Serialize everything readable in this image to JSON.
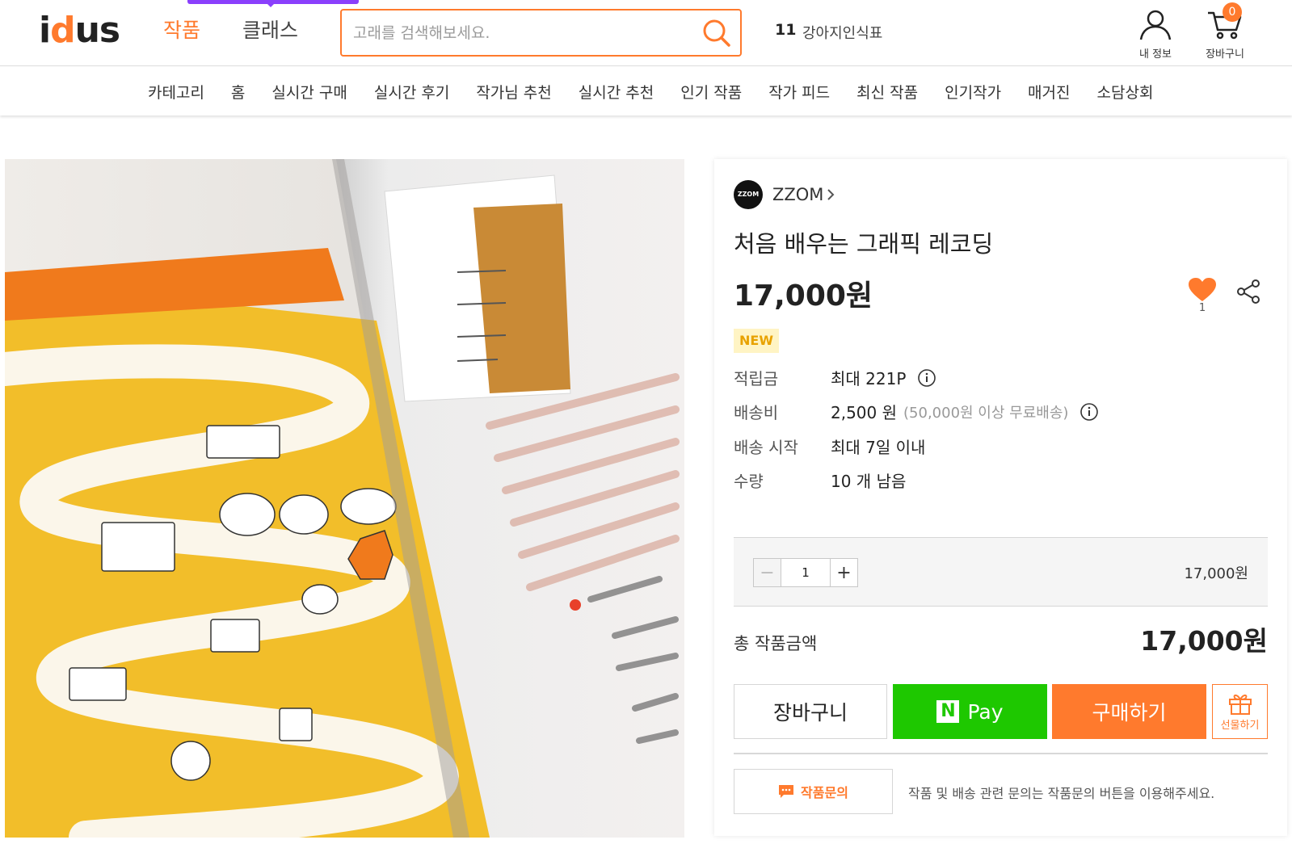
{
  "header": {
    "logo": {
      "text_left": "i",
      "text_mid": "d",
      "text_right": "us"
    },
    "tabs": [
      {
        "label": "작품",
        "active": true
      },
      {
        "label": "클래스",
        "active": false
      }
    ],
    "search": {
      "placeholder": "고래를 검색해보세요.",
      "value": ""
    },
    "trending": {
      "rank": "11",
      "keyword": "강아지인식표"
    },
    "utilities": {
      "my_info_label": "내 정보",
      "cart_label": "장바구니",
      "cart_count": "0"
    },
    "accent_color": "#ff7a2d",
    "highlight_color": "#8a3ffc"
  },
  "category_bar": {
    "items": [
      "카테고리",
      "홈",
      "실시간 구매",
      "실시간 후기",
      "작가님 추천",
      "실시간 추천",
      "인기 작품",
      "작가 피드",
      "최신 작품",
      "인기작가",
      "매거진",
      "소담상회"
    ]
  },
  "product": {
    "artist": {
      "avatar_text": "ZZOM",
      "name": "ZZOM"
    },
    "title": "처음 배우는 그래픽 레코딩",
    "price": "17,000원",
    "like_count": "1",
    "badge": "NEW",
    "info": [
      {
        "label": "적립금",
        "value": "최대 221P",
        "sub": "",
        "has_info_icon": true
      },
      {
        "label": "배송비",
        "value": "2,500 원",
        "sub": "(50,000원 이상 무료배송)",
        "has_info_icon": true
      },
      {
        "label": "배송 시작",
        "value": "최대 7일 이내",
        "sub": "",
        "has_info_icon": false
      },
      {
        "label": "수량",
        "value": "10 개 남음",
        "sub": "",
        "has_info_icon": false
      }
    ],
    "quantity": {
      "value": "1",
      "line_price": "17,000원"
    },
    "total": {
      "label": "총 작품금액",
      "value": "17,000원"
    },
    "buttons": {
      "cart": "장바구니",
      "npay": "Pay",
      "npay_mark": "N",
      "buy": "구매하기",
      "gift": "선물하기"
    },
    "inquiry": {
      "button": "작품문의",
      "note": "작품 및 배송 관련 문의는 작품문의 버튼을 이용해주세요."
    },
    "colors": {
      "npay_green": "#1ec800",
      "buy_orange": "#ff7a2d",
      "heart": "#ff7a2d"
    }
  }
}
